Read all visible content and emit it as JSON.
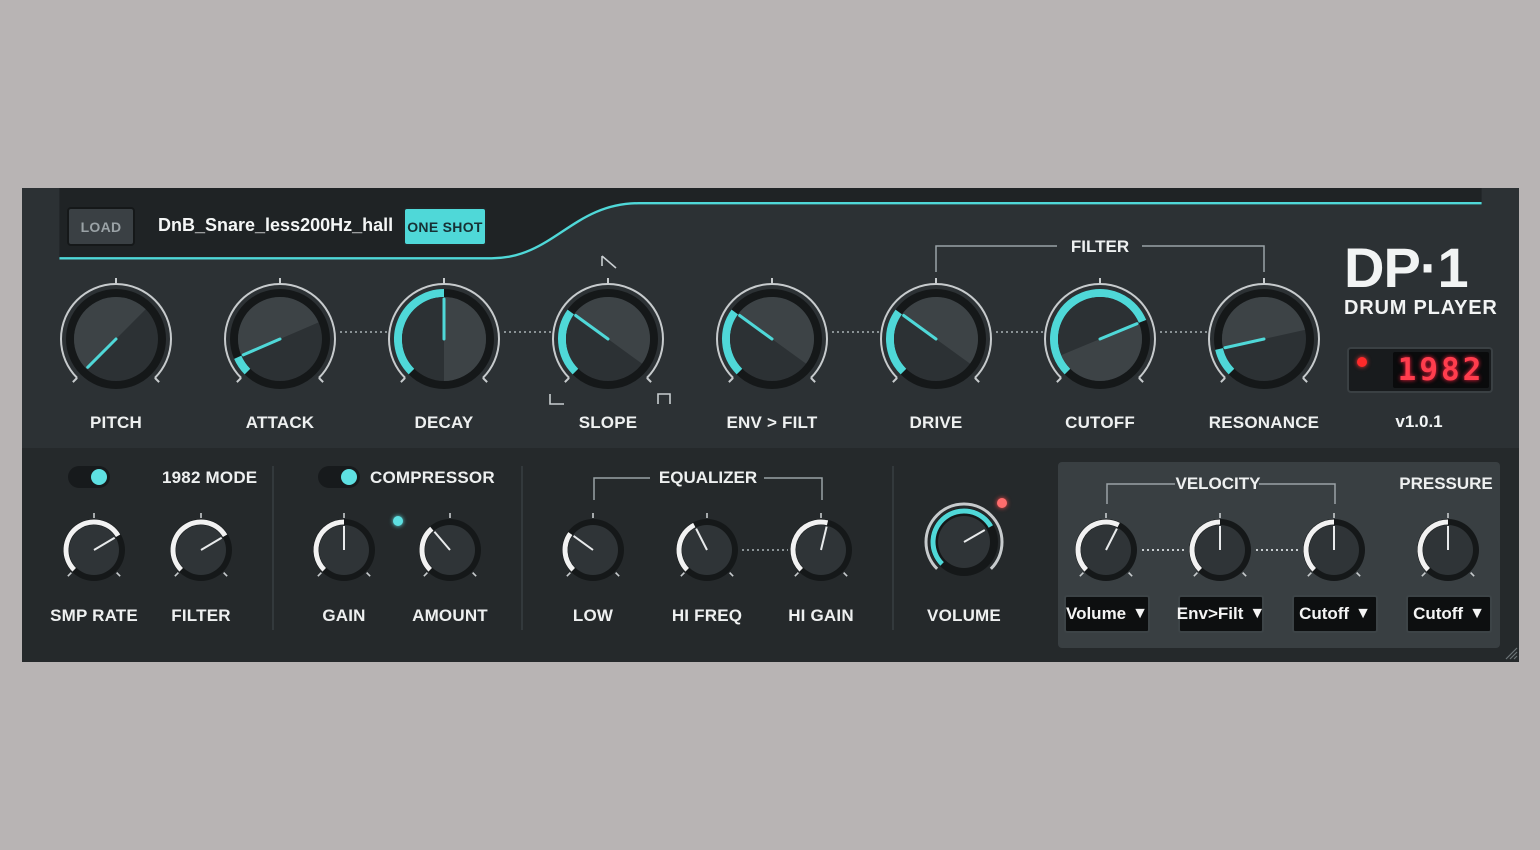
{
  "header": {
    "load_label": "LOAD",
    "filename": "DnB_Snare_less200Hz_hall",
    "oneshot_label": "ONE SHOT"
  },
  "filter_group_label": "FILTER",
  "main_knobs": [
    {
      "label": "PITCH",
      "value": 0.0
    },
    {
      "label": "ATTACK",
      "value": 0.08
    },
    {
      "label": "DECAY",
      "value": 0.5
    },
    {
      "label": "SLOPE",
      "value": 0.3
    },
    {
      "label": "ENV > FILT",
      "value": 0.3
    },
    {
      "label": "DRIVE",
      "value": 0.3
    },
    {
      "label": "CUTOFF",
      "value": 0.75
    },
    {
      "label": "RESONANCE",
      "value": 0.12
    }
  ],
  "logo": {
    "title": "DP·1",
    "subtitle": "DRUM PLAYER",
    "display_value": "1982",
    "version": "v1.0.1"
  },
  "bottom": {
    "mode_label": "1982 MODE",
    "mode_on": true,
    "smp_rate_label": "SMP RATE",
    "filter_label": "FILTER",
    "compressor_label": "COMPRESSOR",
    "compressor_on": true,
    "gain_label": "GAIN",
    "amount_label": "AMOUNT",
    "equalizer_label": "EQUALIZER",
    "low_label": "LOW",
    "hifreq_label": "HI FREQ",
    "higain_label": "HI GAIN",
    "volume_label": "VOLUME",
    "velocity_label": "VELOCITY",
    "pressure_label": "PRESSURE",
    "dropdowns": [
      "Volume",
      "Env>Filt",
      "Cutoff",
      "Cutoff"
    ]
  },
  "colors": {
    "accent": "#4fd8d8",
    "panel": "#2a2f32",
    "led_red": "#ff3d4d"
  }
}
